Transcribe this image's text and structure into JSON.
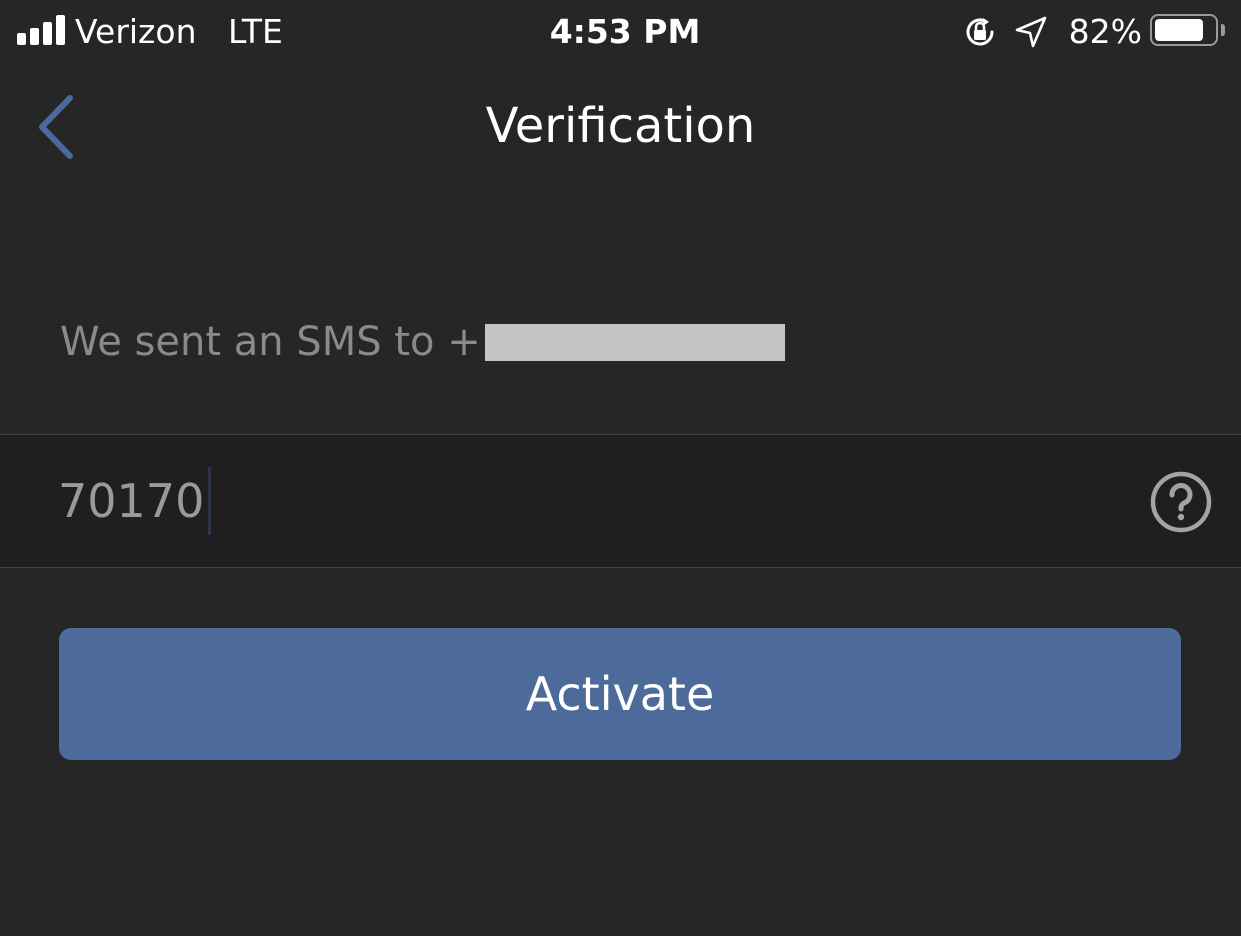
{
  "status_bar": {
    "carrier": "Verizon",
    "network": "LTE",
    "time": "4:53 PM",
    "battery_percent_label": "82%",
    "battery_level": 0.82,
    "signal_bars": 4,
    "icons": [
      "signal-icon",
      "rotation-lock-icon",
      "location-arrow-icon",
      "battery-icon"
    ]
  },
  "nav": {
    "title": "Verification",
    "back_icon": "chevron-left-icon"
  },
  "message": {
    "sms_prefix": "We sent an SMS to +",
    "phone_redacted": true
  },
  "code_field": {
    "value": "70170",
    "help_icon": "question-circle-icon"
  },
  "activate_button": {
    "label": "Activate"
  },
  "colors": {
    "background": "#262626",
    "field_background": "#1f1f1f",
    "accent": "#4c6b9a",
    "back_chevron": "#4a6a9e",
    "muted_text": "#8a8a8a"
  }
}
